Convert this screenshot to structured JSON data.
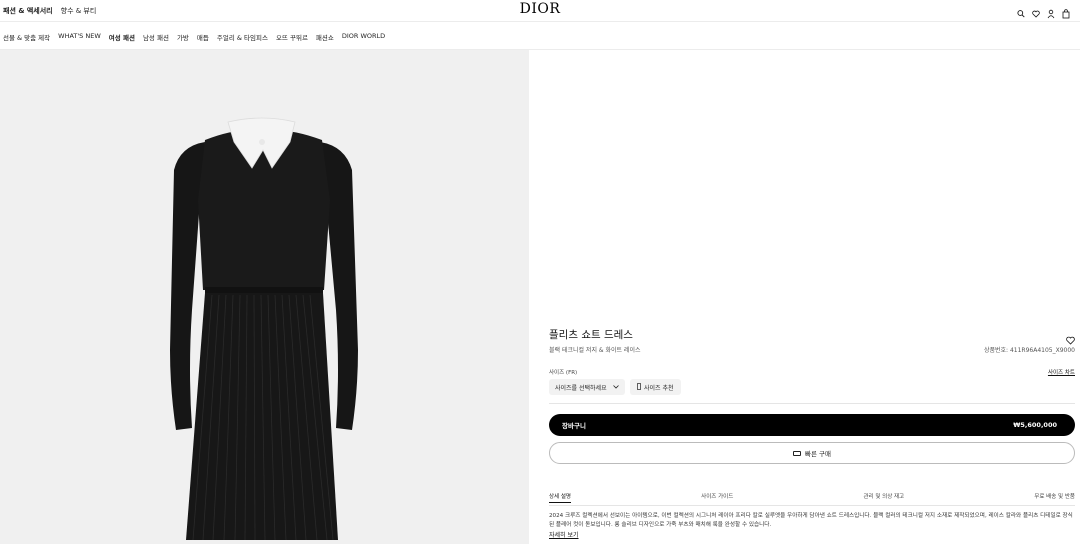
{
  "header": {
    "top_links": [
      "패션 & 액세서리",
      "향수 & 뷰티"
    ],
    "logo": "DIOR",
    "icons": [
      "search-icon",
      "heart-icon",
      "user-icon",
      "bag-icon"
    ]
  },
  "nav": {
    "items": [
      "선물 & 맞춤 제작",
      "WHAT'S NEW",
      "여성 패션",
      "남성 패션",
      "가방",
      "매듭",
      "주얼리 & 타임피스",
      "오뜨 꾸뛰르",
      "패션쇼",
      "DIOR WORLD"
    ]
  },
  "product": {
    "title": "플리츠 쇼트 드레스",
    "subtitle": "블랙 테크니컬 저지 & 화이트 레이스",
    "reference": "상품번호: 411R96A4105_X9000",
    "size_label": "사이즈 (FR)",
    "size_chart": "사이즈 차트",
    "size_select": "사이즈를 선택하세요",
    "size_recommend": "사이즈 추천",
    "cart_label": "장바구니",
    "price": "₩5,600,000",
    "quick_buy": "빠른 구매"
  },
  "tabs": [
    "상세 설명",
    "사이즈 가이드",
    "관리 및 의상 재고",
    "무료 배송 및 반품"
  ],
  "description": {
    "text": "2024 크루즈 컬렉션에서 선보이는 아이템으로, 이번 컬렉션의 시그니처 레이아 프리다 칼로 실루엣을 우아하게 담아낸 쇼트 드레스입니다. 블랙 컬러의 테크니컬 저지 소재로 제작되었으며, 레이스 칼라와 플리츠 디테일로 장식된 플레어 컷이 돋보입니다. 롱 슬리브 디자인으로 가죽 부츠와 매치해 룩을 완성할 수 있습니다.",
    "more": "자세히 보기"
  },
  "colors": {
    "image_bg": "#f0f0f0",
    "dress": "#161616",
    "collar": "#f4f4f4",
    "button_bg": "#000000"
  }
}
